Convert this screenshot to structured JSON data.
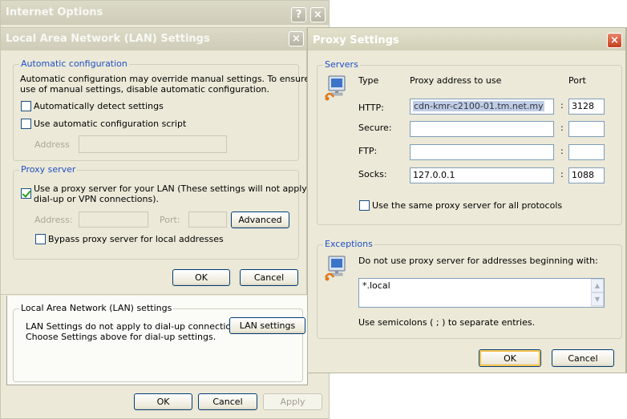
{
  "internet_options": {
    "title": "Internet Options",
    "lan_group_title": "Local Area Network (LAN) settings",
    "lan_text_line1": "LAN Settings do not apply to dial-up connections.",
    "lan_text_line2": "Choose Settings above for dial-up settings.",
    "lan_settings_button": "LAN settings",
    "ok": "OK",
    "cancel": "Cancel",
    "apply": "Apply"
  },
  "lan_dialog": {
    "title": "Local Area Network (LAN) Settings",
    "auto_group_title": "Automatic configuration",
    "auto_desc_line1": "Automatic configuration may override manual settings.  To ensure the",
    "auto_desc_line2": "use of manual settings, disable automatic configuration.",
    "auto_detect_label": "Automatically detect settings",
    "auto_detect_checked": false,
    "auto_script_label": "Use automatic configuration script",
    "auto_script_checked": false,
    "address_label": "Address",
    "address_value": "",
    "proxy_group_title": "Proxy server",
    "use_proxy_line1": "Use a proxy server for your LAN (These settings will not apply to",
    "use_proxy_line2": "dial-up or VPN connections).",
    "use_proxy_checked": true,
    "proxy_address_label": "Address:",
    "proxy_port_label": "Port:",
    "advanced_button": "Advanced",
    "bypass_label": "Bypass proxy server for local addresses",
    "bypass_checked": false,
    "ok": "OK",
    "cancel": "Cancel"
  },
  "proxy_dialog": {
    "title": "Proxy Settings",
    "servers_group_title": "Servers",
    "col_type": "Type",
    "col_address": "Proxy address to use",
    "col_port": "Port",
    "rows": [
      {
        "type": "HTTP:",
        "address": "cdn-kmr-c2100-01.tm.net.my",
        "port": "3128"
      },
      {
        "type": "Secure:",
        "address": "",
        "port": ""
      },
      {
        "type": "FTP:",
        "address": "",
        "port": ""
      },
      {
        "type": "Socks:",
        "address": "127.0.0.1",
        "port": "1088"
      }
    ],
    "colon": ":",
    "same_proxy_label": "Use the same proxy server for all protocols",
    "same_proxy_checked": false,
    "exceptions_group_title": "Exceptions",
    "exceptions_desc": "Do not use proxy server for addresses beginning with:",
    "exceptions_value": "*.local",
    "exceptions_hint": "Use semicolons ( ; ) to separate entries.",
    "ok": "OK",
    "cancel": "Cancel"
  },
  "titlebar_icons": {
    "help": "?",
    "close": "×"
  }
}
